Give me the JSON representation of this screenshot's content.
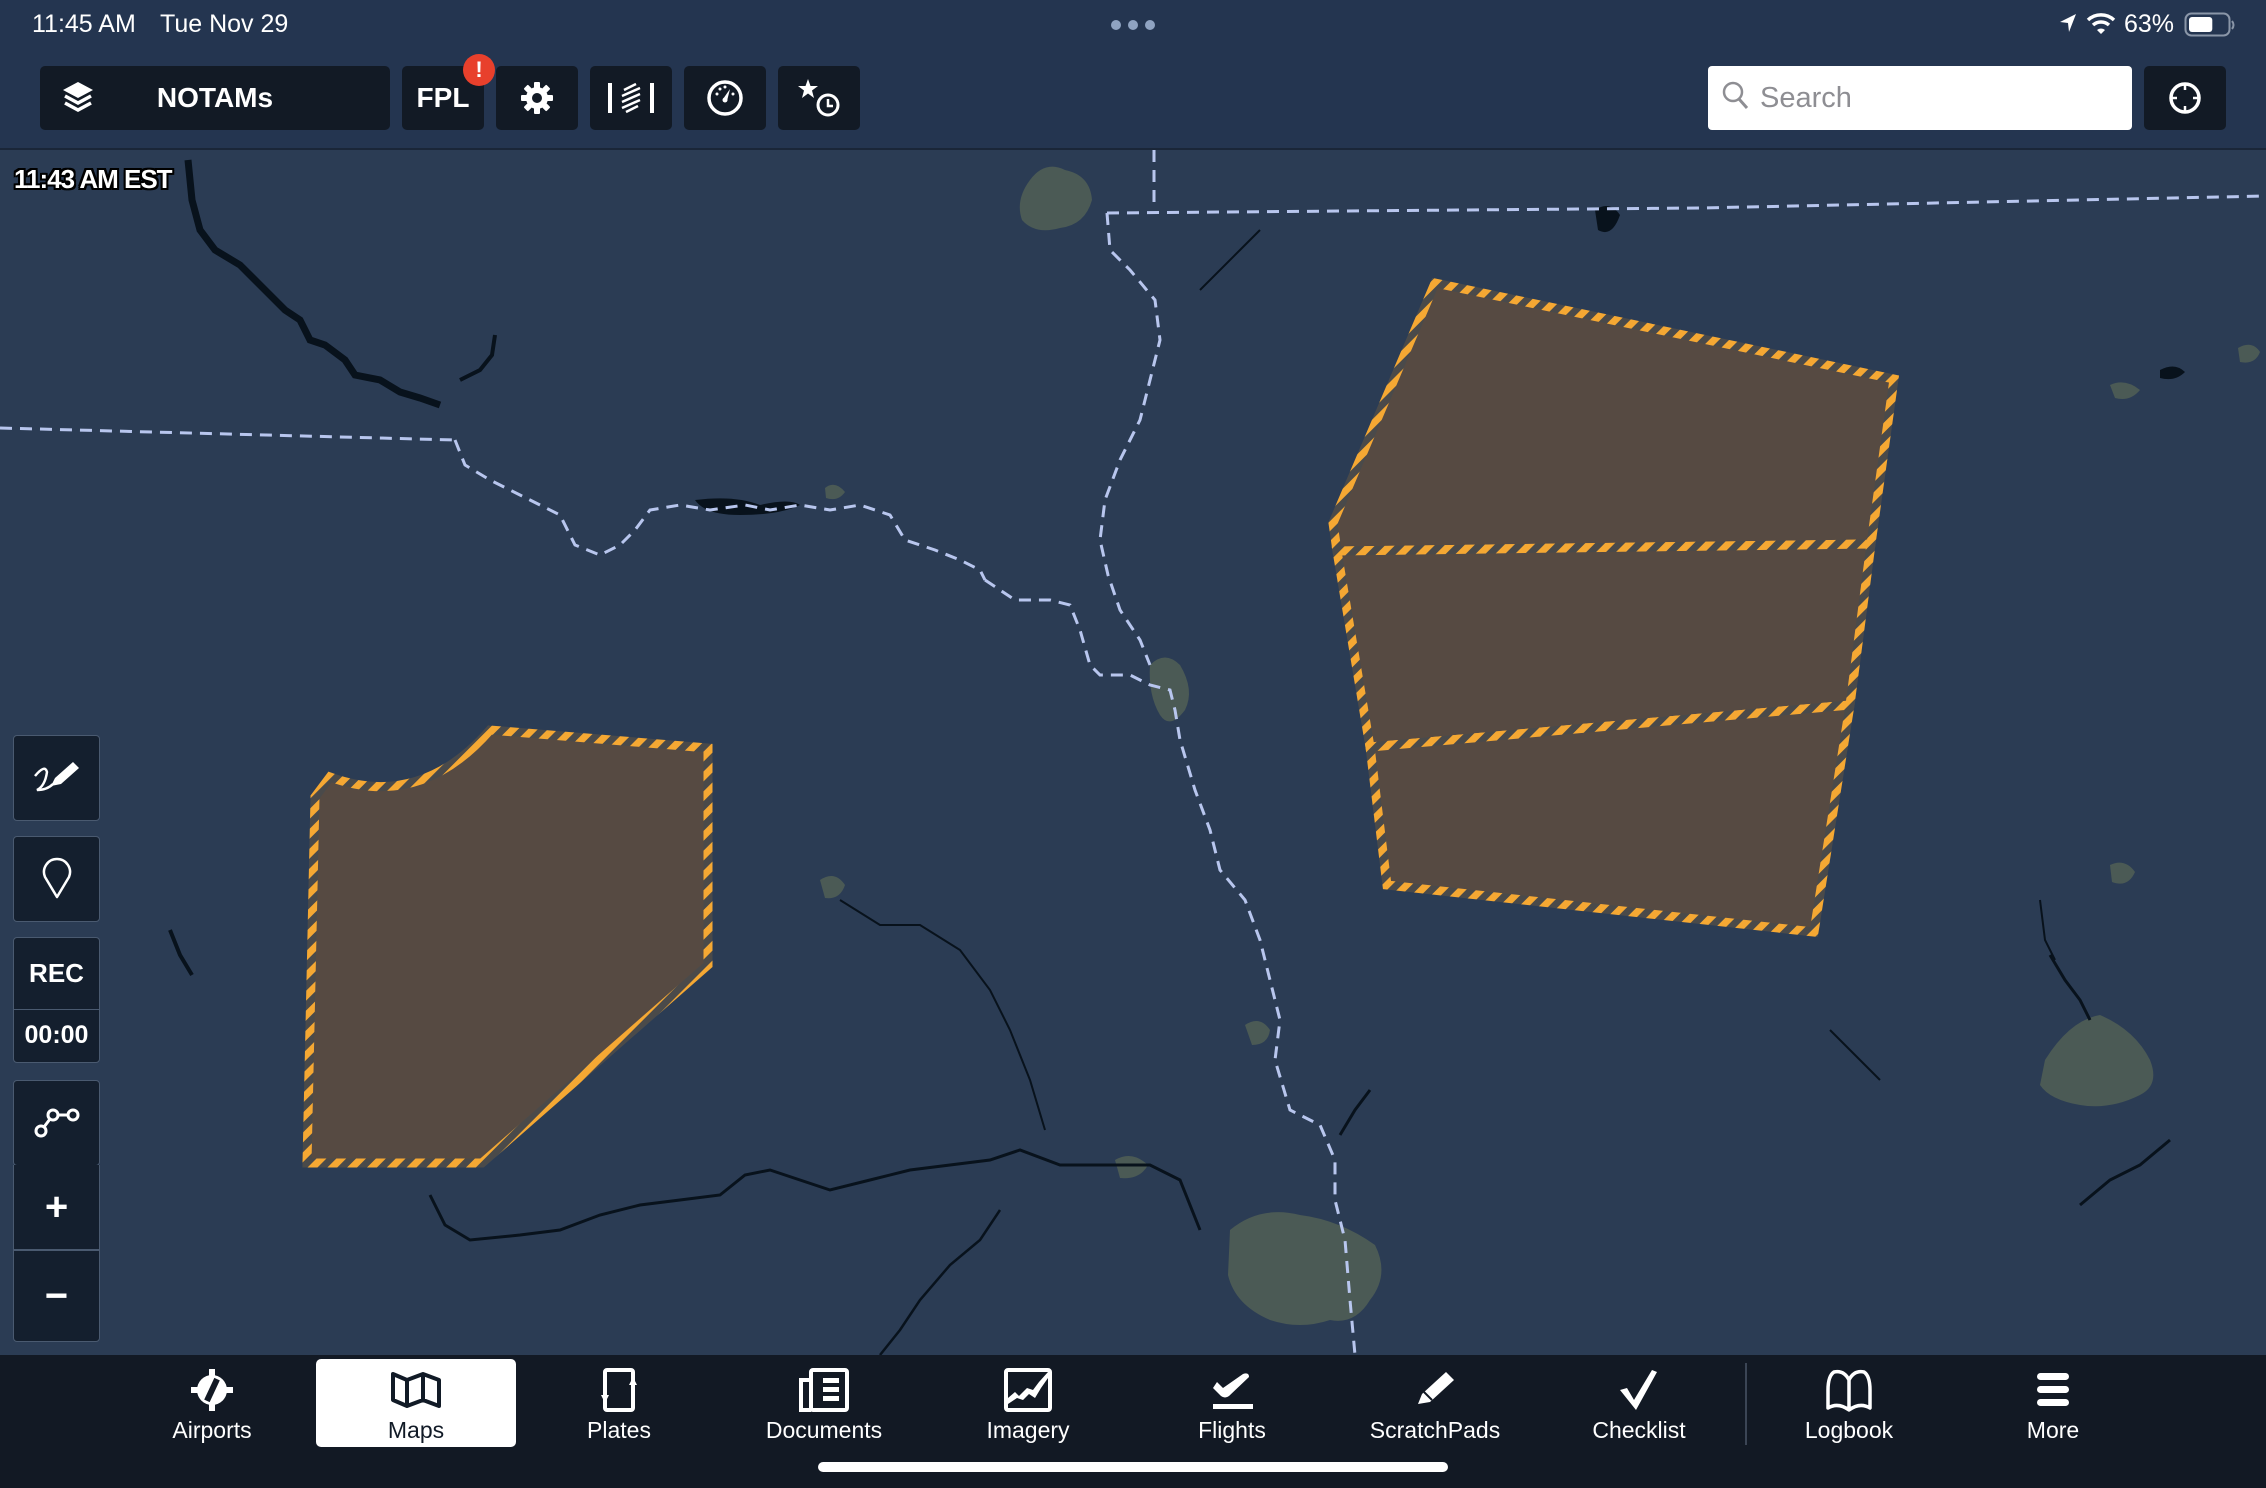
{
  "status_bar": {
    "time": "11:45 AM",
    "date": "Tue Nov 29",
    "battery_percent": "63%",
    "battery_level": 0.63
  },
  "toolbar": {
    "layers_label": "NOTAMs",
    "fpl_label": "FPL",
    "fpl_badge": "!",
    "search_placeholder": "Search",
    "search_value": ""
  },
  "map": {
    "timestamp": "11:43 AM EST",
    "notam_colors": {
      "fill": "#564a42",
      "stripe_a": "#f5a833",
      "stripe_b": "#4a4a4a"
    },
    "background_color": "#2b3c54",
    "urban_color": "#4b5a55",
    "border_color": "#b8c6ee",
    "water_color": "#08121c"
  },
  "left_controls": {
    "rec_label": "REC",
    "rec_timer": "00:00",
    "zoom_in": "+",
    "zoom_out": "−"
  },
  "tabs": [
    {
      "label": "Airports",
      "icon": "airports-icon",
      "active": false
    },
    {
      "label": "Maps",
      "icon": "maps-icon",
      "active": true
    },
    {
      "label": "Plates",
      "icon": "plates-icon",
      "active": false
    },
    {
      "label": "Documents",
      "icon": "documents-icon",
      "active": false
    },
    {
      "label": "Imagery",
      "icon": "imagery-icon",
      "active": false
    },
    {
      "label": "Flights",
      "icon": "flights-icon",
      "active": false
    },
    {
      "label": "ScratchPads",
      "icon": "scratchpads-icon",
      "active": false
    },
    {
      "label": "Checklist",
      "icon": "checklist-icon",
      "active": false
    },
    {
      "label": "Logbook",
      "icon": "logbook-icon",
      "active": false
    },
    {
      "label": "More",
      "icon": "more-icon",
      "active": false
    }
  ]
}
